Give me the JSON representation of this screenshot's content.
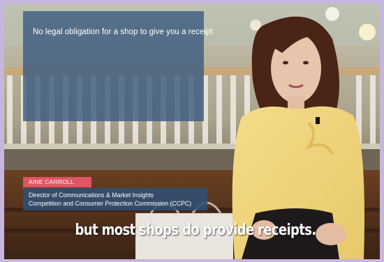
{
  "title_card": {
    "text": "No legal obligation for a shop to give you a receipt"
  },
  "lower_third": {
    "name": "AINE CARROLL",
    "role_line1": "Director of Communications & Market Insights",
    "role_line2": "Competition and Consumer Protection Commission (CCPC)"
  },
  "subtitle": {
    "text": "but most shops do provide receipts."
  },
  "colors": {
    "border": "#c7b6dc",
    "name_tag": "#e05464",
    "role_box": "#304e74",
    "title_card": "#3e5c80"
  }
}
